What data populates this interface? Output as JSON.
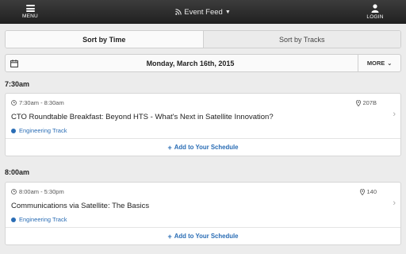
{
  "topbar": {
    "menu_label": "MENU",
    "title": "Event Feed",
    "login_label": "LOGIN"
  },
  "sort": {
    "time_label": "Sort by Time",
    "tracks_label": "Sort by Tracks",
    "active": "time"
  },
  "datebar": {
    "date": "Monday, March 16th, 2015",
    "more_label": "MORE"
  },
  "sessions": [
    {
      "header": "7:30am",
      "time": "7:30am - 8:30am",
      "room": "207B",
      "title": "CTO Roundtable Breakfast: Beyond HTS - What's Next in Satellite Innovation?",
      "track": "Engineering Track",
      "action": "Add to Your Schedule"
    },
    {
      "header": "8:00am",
      "time": "8:00am - 5:30pm",
      "room": "140",
      "title": "Communications via Satellite: The Basics",
      "track": "Engineering Track",
      "action": "Add to Your Schedule"
    }
  ],
  "colors": {
    "topbar": "#2a2a2a",
    "track_dot": "#2a6db5",
    "link": "#2a6db5",
    "background": "#ececec"
  },
  "icons": [
    "hamburger-icon",
    "rss-icon",
    "user-icon",
    "calendar-icon",
    "clock-icon",
    "map-pin-icon",
    "chevron-right-icon",
    "plus-icon"
  ]
}
